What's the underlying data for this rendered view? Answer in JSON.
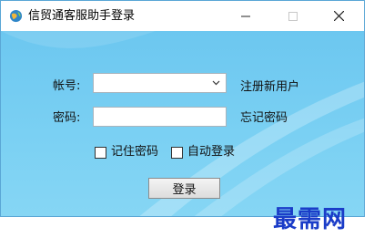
{
  "window": {
    "title": "信贸通客服助手登录",
    "icon": "app-globe-icon",
    "controls": {
      "minimize": "minimize-icon",
      "maximize": "maximize-icon",
      "close": "close-icon"
    }
  },
  "form": {
    "account_label": "帐号:",
    "account_value": "",
    "password_label": "密码:",
    "password_value": "",
    "register_link": "注册新用户",
    "forgot_link": "忘记密码",
    "remember_label": "记住密码",
    "remember_checked": false,
    "auto_login_label": "自动登录",
    "auto_login_checked": false,
    "login_button": "登录"
  },
  "watermark": "最需网",
  "colors": {
    "accent": "#6cc7f0",
    "border": "#5aa7d6",
    "watermark": "#1a3cc8"
  }
}
